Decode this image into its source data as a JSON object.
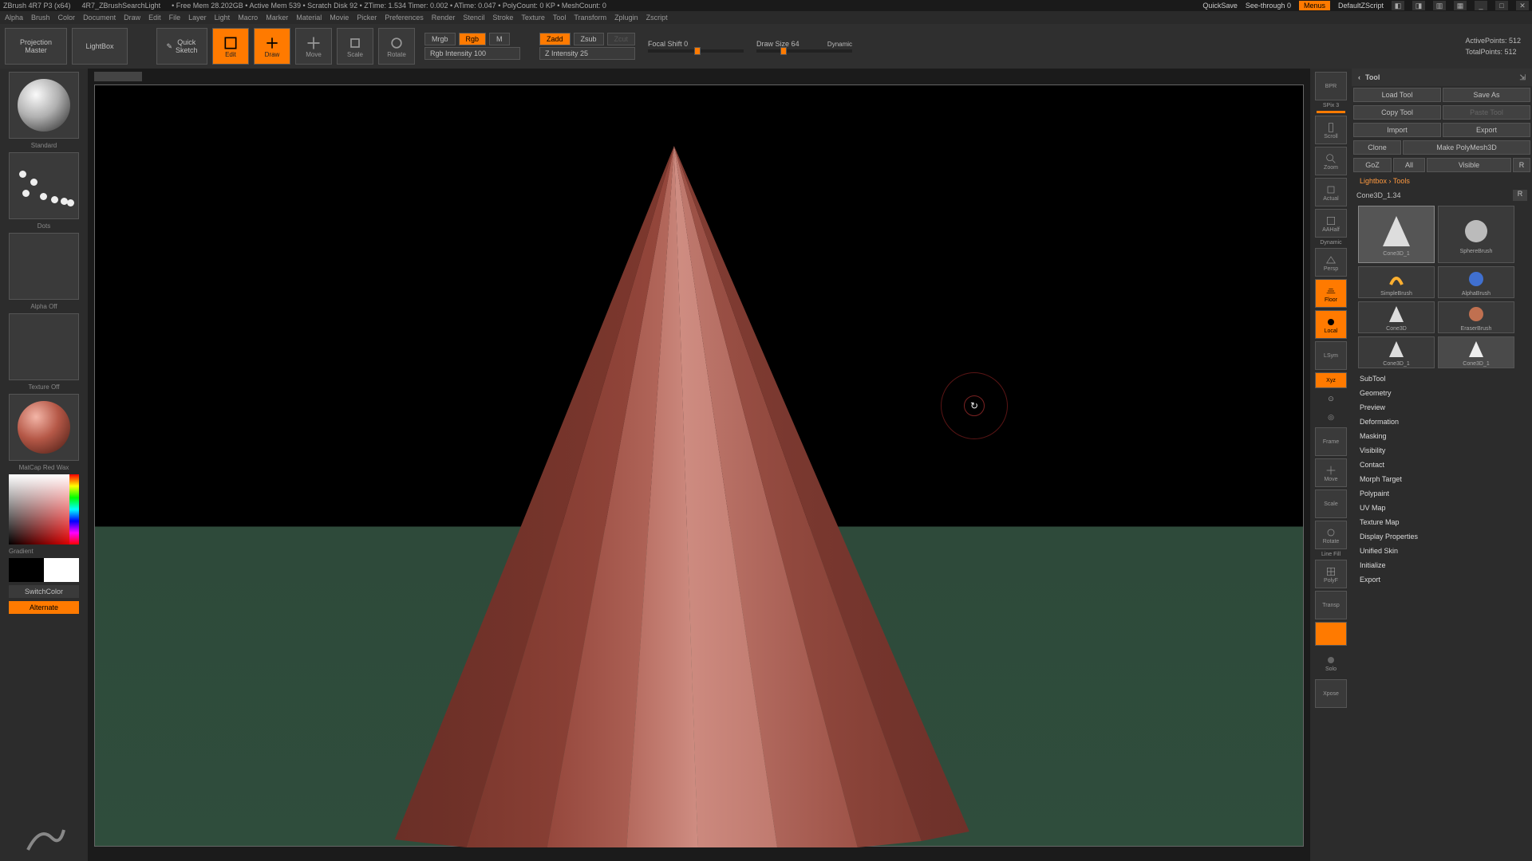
{
  "title": {
    "app": "ZBrush 4R7 P3 (x64)",
    "doc": "4R7_ZBrushSearchLight",
    "mem": "• Free Mem 28.202GB  • Active Mem 539  • Scratch Disk 92  • ZTime: 1.534 Timer: 0.002  • ATime: 0.047  • PolyCount: 0 KP  • MeshCount: 0",
    "quicksave": "QuickSave",
    "seethrough": "See-through   0",
    "menus": "Menus",
    "script": "DefaultZScript"
  },
  "menubar": [
    "Alpha",
    "Brush",
    "Color",
    "Document",
    "Draw",
    "Edit",
    "File",
    "Layer",
    "Light",
    "Macro",
    "Marker",
    "Material",
    "Movie",
    "Picker",
    "Preferences",
    "Render",
    "Stencil",
    "Stroke",
    "Texture",
    "Tool",
    "Transform",
    "Zplugin",
    "Zscript"
  ],
  "toolbar": {
    "projection": "Projection\nMaster",
    "lightbox": "LightBox",
    "quicksketch": "Quick\nSketch",
    "edit": "Edit",
    "draw": "Draw",
    "move": "Move",
    "scale": "Scale",
    "rotate": "Rotate",
    "mrgb": "Mrgb",
    "rgb": "Rgb",
    "m": "M",
    "rgb_int": "Rgb Intensity 100",
    "zadd": "Zadd",
    "zsub": "Zsub",
    "zcut": "Zcut",
    "z_int": "Z Intensity 25",
    "focal": "Focal Shift 0",
    "drawsize": "Draw Size 64",
    "dynamic": "Dynamic",
    "active": "ActivePoints: 512",
    "total": "TotalPoints: 512"
  },
  "left": {
    "brush": "Standard",
    "stroke": "Dots",
    "alpha": "Alpha Off",
    "texture": "Texture Off",
    "material": "MatCap Red Wax",
    "gradient": "Gradient",
    "switchcolor": "SwitchColor",
    "alternate": "Alternate"
  },
  "view": {
    "bpr": "BPR",
    "spix": "SPix 3",
    "scroll": "Scroll",
    "zoom": "Zoom",
    "actual": "Actual",
    "aahalf": "AAHalf",
    "persp": "Persp",
    "floor": "Floor",
    "local": "Local",
    "lsym": "LSym",
    "xyz": "Xyz",
    "frame": "Frame",
    "move": "Move",
    "scale": "Scale",
    "rotate": "Rotate",
    "polyF": "PolyF",
    "linefill": "Line Fill",
    "transp": "Transp",
    "dynamic": "Dynamic",
    "solo": "Solo",
    "xpose": "Xpose"
  },
  "right": {
    "panel": "Tool",
    "row1": {
      "load": "Load Tool",
      "save": "Save As"
    },
    "row2": {
      "copy": "Copy Tool",
      "paste": "Paste Tool"
    },
    "row3": {
      "import": "Import",
      "export": "Export"
    },
    "row4": {
      "clone": "Clone",
      "poly": "Make PolyMesh3D"
    },
    "row5": {
      "goz": "GoZ",
      "all": "All",
      "visible": "Visible",
      "r": "R"
    },
    "lightbox": "Lightbox › Tools",
    "toolname": "Cone3D_1.34",
    "r": "R",
    "tools": {
      "cone": "Cone3D_1",
      "sphere": "SphereBrush",
      "alpha": "AlphaBrush",
      "simple": "SimpleBrush",
      "eraser": "EraserBrush",
      "cone2": "Cone3D",
      "cone3": "Cone3D_1"
    },
    "accordion": [
      "SubTool",
      "Geometry",
      "Preview",
      "Deformation",
      "Masking",
      "Visibility",
      "Contact",
      "Morph Target",
      "Polypaint",
      "UV Map",
      "Texture Map",
      "Display Properties",
      "Unified Skin",
      "Initialize",
      "Export"
    ]
  }
}
